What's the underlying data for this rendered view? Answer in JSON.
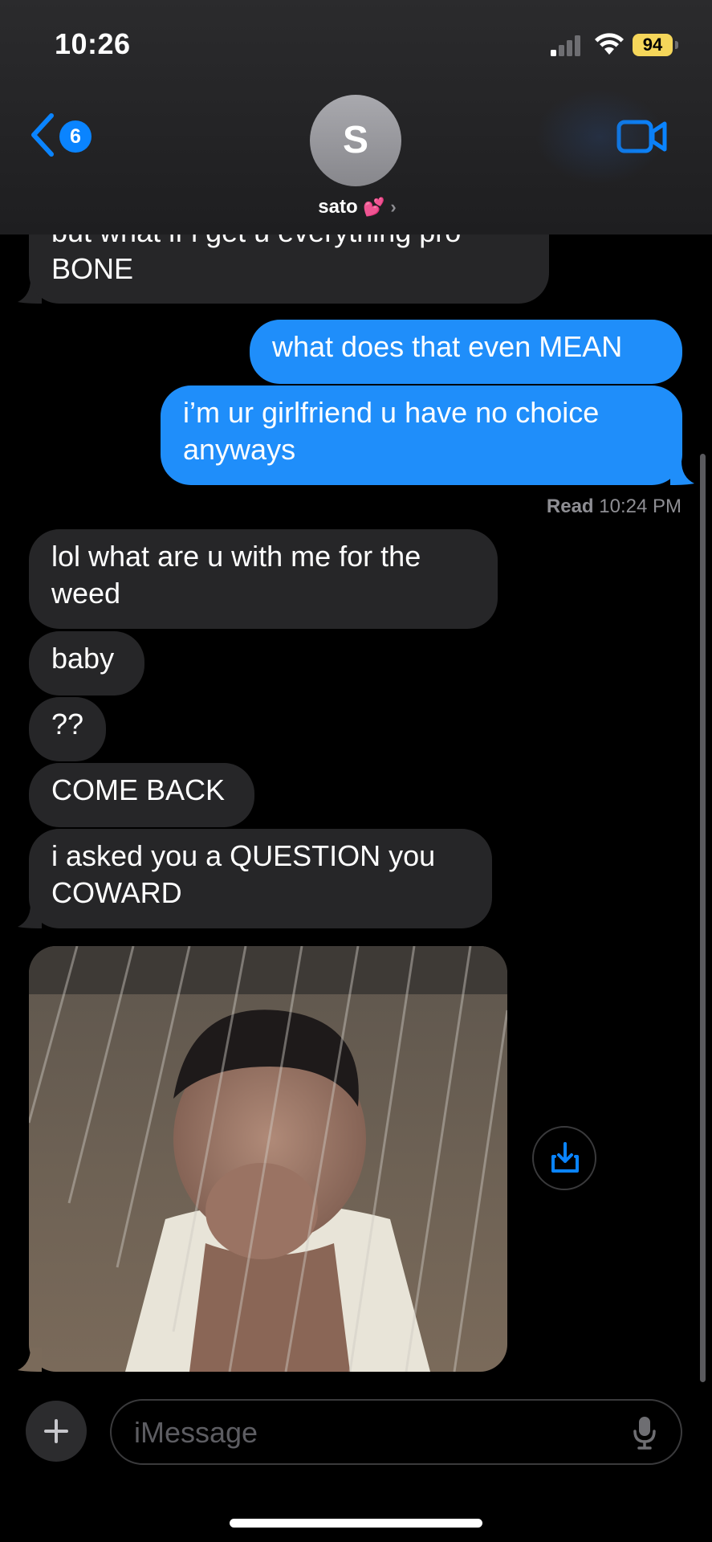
{
  "status_bar": {
    "time": "10:26",
    "battery": "94"
  },
  "header": {
    "back_badge": "6",
    "avatar_initial": "S",
    "contact_name": "sato",
    "contact_emoji": "💕",
    "chevron": "›"
  },
  "messages": [
    {
      "dir": "in",
      "text": "but what if i get u everything pro BONE"
    },
    {
      "dir": "out",
      "text": "what does that even MEAN"
    },
    {
      "dir": "out",
      "text": "i’m ur girlfriend u have no choice anyways"
    },
    {
      "dir": "in",
      "text": "lol what are u with me for the weed"
    },
    {
      "dir": "in",
      "text": "baby"
    },
    {
      "dir": "in",
      "text": "??"
    },
    {
      "dir": "in",
      "text": "COME BACK"
    },
    {
      "dir": "in",
      "text": "i asked you a QUESTION you COWARD"
    }
  ],
  "read_receipt": {
    "label": "Read",
    "time": "10:24 PM"
  },
  "photo": {
    "alt": "image-attachment"
  },
  "composer": {
    "placeholder": "iMessage"
  },
  "colors": {
    "outgoing": "#1f8efa",
    "incoming": "#262628",
    "accent": "#0a84ff"
  },
  "icons": [
    "back-chevron-icon",
    "video-call-icon",
    "save-download-icon",
    "plus-icon",
    "microphone-icon",
    "signal-icon",
    "wifi-icon",
    "battery-icon"
  ]
}
